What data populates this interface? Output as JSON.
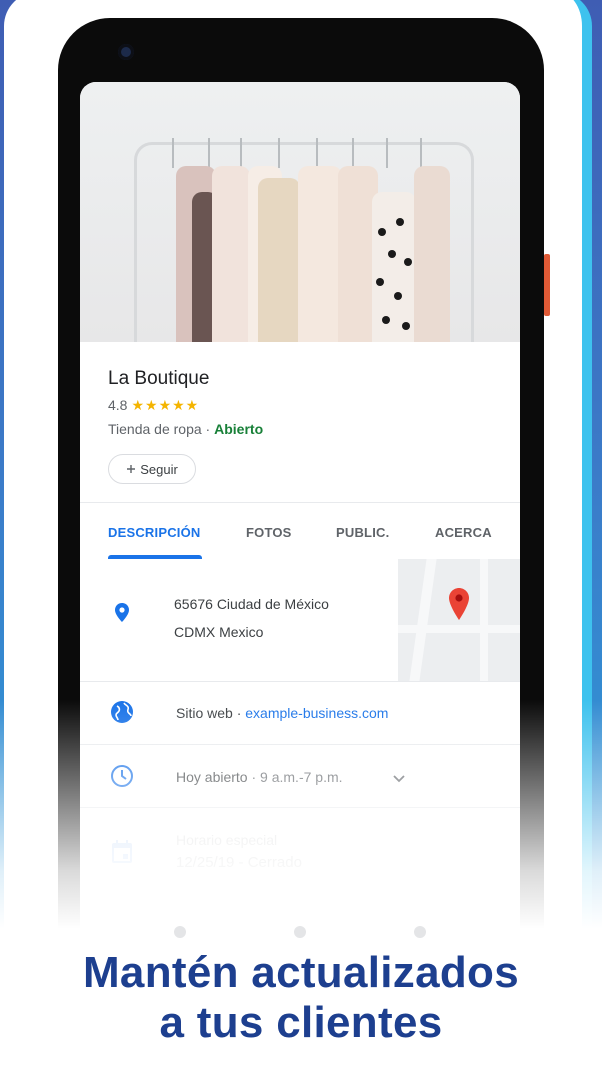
{
  "business": {
    "name": "La Boutique",
    "rating": "4.8",
    "stars": "★★★★★",
    "category": "Tienda de ropa",
    "separator": " · ",
    "status": "Abierto",
    "follow_label": "Seguir"
  },
  "tabs": [
    {
      "label": "DESCRIPCIÓN"
    },
    {
      "label": "FOTOS"
    },
    {
      "label": "PUBLIC."
    },
    {
      "label": "ACERCA"
    }
  ],
  "address": {
    "line1": "65676 Ciudad de México",
    "line2": "CDMX Mexico"
  },
  "website": {
    "label": "Sitio web",
    "separator": " · ",
    "url": "example-business.com"
  },
  "hours": {
    "label": "Hoy abierto",
    "separator": " · ",
    "value": "9 a.m.-7 p.m."
  },
  "special_hours": {
    "label": "Horario especial",
    "value": "12/25/19 - Cerrado"
  },
  "headline": {
    "line1": "Mantén actualizados",
    "line2": "a tus clientes"
  },
  "icons": {
    "address": "location-pin-icon",
    "website": "globe-icon",
    "hours": "clock-icon",
    "special": "calendar-icon",
    "map_marker": "map-marker-icon",
    "expand": "chevron-down-icon",
    "follow": "plus-icon"
  },
  "colors": {
    "accent": "#1a73e8",
    "open": "#188038",
    "stars": "#f4b400",
    "headline": "#1d3f8f",
    "frame": "#3ec2ee",
    "side_button": "#e05a36"
  }
}
